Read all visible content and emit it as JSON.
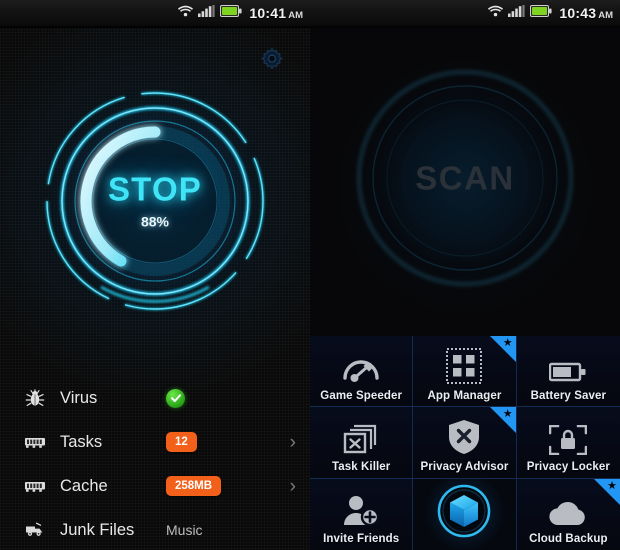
{
  "left": {
    "status": {
      "time": "10:41",
      "ampm": "AM",
      "wifi_icon": "wifi-icon",
      "signal_icon": "signal-icon",
      "battery_icon": "battery-icon"
    },
    "settings_icon": "gear-icon",
    "dial": {
      "label": "STOP",
      "percent": "88%",
      "percent_value": 88
    },
    "rows": [
      {
        "icon": "bug-icon",
        "label": "Virus",
        "value": "",
        "value_type": "ok",
        "badge_color": "#2bb517",
        "chevron": ""
      },
      {
        "icon": "memory-icon",
        "label": "Tasks",
        "value": "12",
        "value_type": "badge",
        "badge_color": "#f2601a",
        "chevron": "›"
      },
      {
        "icon": "memory-icon",
        "label": "Cache",
        "value": "258MB",
        "value_type": "badge",
        "badge_color": "#f2601a",
        "chevron": "›"
      },
      {
        "icon": "junk-icon",
        "label": "Junk Files",
        "value": "Music",
        "value_type": "text",
        "badge_color": "",
        "chevron": ""
      }
    ]
  },
  "right": {
    "status": {
      "time": "10:43",
      "ampm": "AM",
      "wifi_icon": "wifi-icon",
      "signal_icon": "signal-icon",
      "battery_icon": "battery-icon"
    },
    "dial": {
      "label": "SCAN"
    },
    "tiles": [
      {
        "icon": "speedometer-icon",
        "label": "Game Speeder",
        "badge": false
      },
      {
        "icon": "app-grid-icon",
        "label": "App Manager",
        "badge": true
      },
      {
        "icon": "battery-icon",
        "label": "Battery Saver",
        "badge": false
      },
      {
        "icon": "task-kill-icon",
        "label": "Task Killer",
        "badge": false
      },
      {
        "icon": "shield-x-icon",
        "label": "Privacy Advisor",
        "badge": true
      },
      {
        "icon": "lock-screen-icon",
        "label": "Privacy Locker",
        "badge": false
      },
      {
        "icon": "invite-person-icon",
        "label": "Invite Friends",
        "badge": false
      },
      {
        "icon": "cube-logo-icon",
        "label": "",
        "badge": false
      },
      {
        "icon": "cloud-icon",
        "label": "Cloud Backup",
        "badge": true
      }
    ]
  },
  "colors": {
    "accent_cyan": "#3fe4f7",
    "badge_orange": "#f2601a",
    "ribbon_blue": "#2196f3",
    "ok_green": "#2bb517"
  }
}
